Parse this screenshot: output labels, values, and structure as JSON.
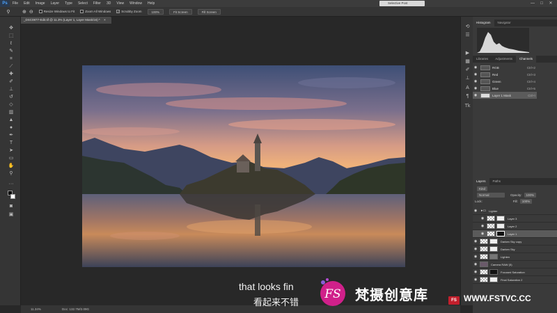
{
  "menubar": {
    "logo": "Ps",
    "items": [
      "File",
      "Edit",
      "Image",
      "Layer",
      "Type",
      "Select",
      "Filter",
      "3D",
      "View",
      "Window",
      "Help"
    ],
    "workspace": "Selective Post",
    "window_buttons": [
      "—",
      "□",
      "✕"
    ]
  },
  "options": {
    "checkboxes": [
      "Resize Windows to Fit",
      "Zoom All Windows",
      "Scrubby Zoom"
    ],
    "scrubby_checked": "✓",
    "buttons": [
      "100%",
      "Fit Screen",
      "Fill Screen"
    ]
  },
  "document": {
    "tab_title": "_DSC0877-Edit.tif @ 11.3% (Layer 1, Layer Mask/16) *",
    "close": "×"
  },
  "status": {
    "zoom": "11.34%",
    "doc": "Doc: 132.7M/2.09G"
  },
  "histogram_tabs": [
    "Histogram",
    "Navigator"
  ],
  "channels_tabs": [
    "Libraries",
    "Adjustments",
    "Channels"
  ],
  "channels": [
    {
      "name": "RGB",
      "key": "Ctrl+2"
    },
    {
      "name": "Red",
      "key": "Ctrl+3"
    },
    {
      "name": "Green",
      "key": "Ctrl+4"
    },
    {
      "name": "Blue",
      "key": "Ctrl+5"
    },
    {
      "name": "Layer 1 Mask",
      "key": "Ctrl+\\"
    }
  ],
  "layers_tabs": [
    "Layers",
    "Paths"
  ],
  "layers_controls": {
    "kind": "Kind",
    "blend": "Normal",
    "opacity_label": "Opacity:",
    "opacity": "100%",
    "lock_label": "Lock:",
    "fill_label": "Fill:",
    "fill": "100%"
  },
  "layers": [
    {
      "name": "Lighter",
      "type": "group"
    },
    {
      "name": "Layer 3",
      "type": "layer"
    },
    {
      "name": "Layer 2",
      "type": "layer"
    },
    {
      "name": "Layer 1",
      "type": "layer"
    },
    {
      "name": "Darken Sky copy",
      "type": "layer"
    },
    {
      "name": "Darken Sky",
      "type": "layer"
    },
    {
      "name": "Lighten",
      "type": "layer"
    },
    {
      "name": "Camera RAW (5)",
      "type": "layer"
    },
    {
      "name": "Focused Saturation",
      "type": "layer"
    },
    {
      "name": "Final Saturation 2",
      "type": "layer"
    }
  ],
  "subtitles": {
    "english": "that looks fin",
    "chinese": "看起来不错"
  },
  "watermark": {
    "logo_text": "FS",
    "brand": "梵摄创意库",
    "url": "WWW.FSTVC.CC",
    "badge": "FS"
  },
  "colors": {
    "ui_bg": "#282828",
    "panel_bg": "#3a3a3a",
    "brand_magenta": "#d0208a",
    "brand_red": "#c21f2c"
  }
}
